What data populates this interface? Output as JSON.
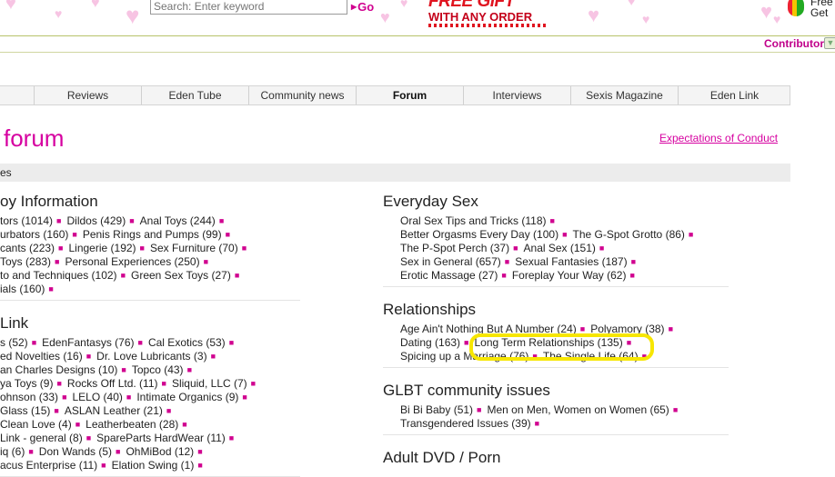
{
  "header": {
    "search_placeholder": "Search: Enter keyword",
    "go_label": "Go",
    "promo_line1": "FREE GIFT",
    "promo_line2": "WITH ANY ORDER",
    "free_gift_text_line1": "Free",
    "free_gift_text_line2": "Get",
    "contributor_label": "Contributor",
    "contributor_toggle_icon": "chevron-down-icon"
  },
  "nav": {
    "tabs": [
      {
        "label": "Reviews",
        "active": false
      },
      {
        "label": "Eden Tube",
        "active": false
      },
      {
        "label": "Community news",
        "active": false
      },
      {
        "label": "Forum",
        "active": true
      },
      {
        "label": "Interviews",
        "active": false
      },
      {
        "label": "Sexis Magazine",
        "active": false
      },
      {
        "label": "Eden Link",
        "active": false
      }
    ]
  },
  "page": {
    "title": "forum",
    "conduct_link": "Expectations of Conduct",
    "breadcrumb": "es"
  },
  "left": {
    "sections": [
      {
        "title": "oy Information",
        "rows": [
          [
            {
              "name": "tors",
              "count": "(1014)"
            },
            {
              "name": "Dildos",
              "count": "(429)"
            },
            {
              "name": "Anal Toys",
              "count": "(244)"
            }
          ],
          [
            {
              "name": "urbators",
              "count": "(160)"
            },
            {
              "name": "Penis Rings and Pumps",
              "count": "(99)"
            }
          ],
          [
            {
              "name": "cants",
              "count": "(223)"
            },
            {
              "name": "Lingerie",
              "count": "(192)"
            },
            {
              "name": "Sex Furniture",
              "count": "(70)"
            }
          ],
          [
            {
              "name": "Toys",
              "count": "(283)"
            },
            {
              "name": "Personal Experiences",
              "count": "(250)"
            }
          ],
          [
            {
              "name": "to and Techniques",
              "count": "(102)"
            },
            {
              "name": "Green Sex Toys",
              "count": "(27)"
            }
          ],
          [
            {
              "name": "ials",
              "count": "(160)"
            }
          ]
        ]
      },
      {
        "title": "Link",
        "rows": [
          [
            {
              "name": "s",
              "count": "(52)"
            },
            {
              "name": "EdenFantasys",
              "count": "(76)"
            },
            {
              "name": "Cal Exotics",
              "count": "(53)"
            }
          ],
          [
            {
              "name": "ed Novelties",
              "count": "(16)"
            },
            {
              "name": "Dr. Love Lubricants",
              "count": "(3)"
            }
          ],
          [
            {
              "name": "an Charles Designs",
              "count": "(10)"
            },
            {
              "name": "Topco",
              "count": "(43)"
            }
          ],
          [
            {
              "name": "ya Toys",
              "count": "(9)"
            },
            {
              "name": "Rocks Off Ltd.",
              "count": "(11)"
            },
            {
              "name": "Sliquid, LLC",
              "count": "(7)"
            }
          ],
          [
            {
              "name": "ohnson",
              "count": "(33)"
            },
            {
              "name": "LELO",
              "count": "(40)"
            },
            {
              "name": "Intimate Organics",
              "count": "(9)"
            }
          ],
          [
            {
              "name": "Glass",
              "count": "(15)"
            },
            {
              "name": "ASLAN Leather",
              "count": "(21)"
            }
          ],
          [
            {
              "name": "Clean Love",
              "count": "(4)"
            },
            {
              "name": "Leatherbeaten",
              "count": "(28)"
            }
          ],
          [
            {
              "name": "Link - general",
              "count": "(8)"
            },
            {
              "name": "SpareParts HardWear",
              "count": "(11)"
            }
          ],
          [
            {
              "name": "iq",
              "count": "(6)"
            },
            {
              "name": "Don Wands",
              "count": "(5)"
            },
            {
              "name": "OhMiBod",
              "count": "(12)"
            }
          ],
          [
            {
              "name": "acus Enterprise",
              "count": "(11)"
            },
            {
              "name": "Elation Swing",
              "count": "(1)"
            }
          ]
        ]
      }
    ]
  },
  "right": {
    "sections": [
      {
        "title": "Everyday Sex",
        "rows": [
          [
            {
              "name": "Oral Sex Tips and Tricks",
              "count": "(118)"
            }
          ],
          [
            {
              "name": "Better Orgasms Every Day",
              "count": "(100)"
            },
            {
              "name": "The G-Spot Grotto",
              "count": "(86)"
            }
          ],
          [
            {
              "name": "The P-Spot Perch",
              "count": "(37)"
            },
            {
              "name": "Anal Sex",
              "count": "(151)"
            }
          ],
          [
            {
              "name": "Sex in General",
              "count": "(657)"
            },
            {
              "name": "Sexual Fantasies",
              "count": "(187)"
            }
          ],
          [
            {
              "name": "Erotic Massage",
              "count": "(27)"
            },
            {
              "name": "Foreplay Your Way",
              "count": "(62)"
            }
          ]
        ]
      },
      {
        "title": "Relationships",
        "rows": [
          [
            {
              "name": "Age Ain't Nothing But A Number",
              "count": "(24)"
            },
            {
              "name": "Polyamory",
              "count": "(38)"
            }
          ],
          [
            {
              "name": "Dating",
              "count": "(163)"
            },
            {
              "name": "Long Term Relationships",
              "count": "(135)"
            }
          ],
          [
            {
              "name": "Spicing up a Marriage",
              "count": "(76)"
            },
            {
              "name": "The Single Life",
              "count": "(64)"
            }
          ]
        ]
      },
      {
        "title": "GLBT community issues",
        "rows": [
          [
            {
              "name": "Bi Bi Baby",
              "count": "(51)"
            },
            {
              "name": "Men on Men, Women on Women",
              "count": "(65)"
            }
          ],
          [
            {
              "name": "Transgendered Issues",
              "count": "(39)"
            }
          ]
        ]
      },
      {
        "title": "Adult DVD / Porn",
        "rows": []
      }
    ]
  },
  "highlight": {
    "color": "#f7e600"
  },
  "colors": {
    "accent": "#d600a0",
    "nav_bg": "#f4f4f4",
    "sep": "#d0008f"
  }
}
